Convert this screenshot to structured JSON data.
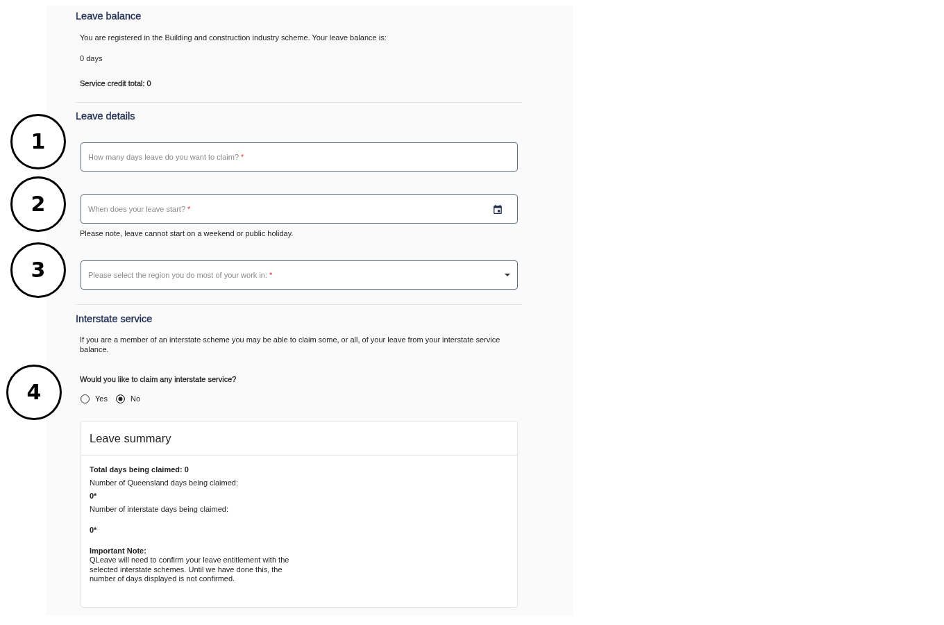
{
  "leave_balance": {
    "heading": "Leave balance",
    "text": "You are registered in the Building and construction industry scheme. Your leave balance is:",
    "balance": "0 days",
    "service_credit": "Service credit total: 0"
  },
  "leave_details": {
    "callout": "1",
    "heading": "Leave details",
    "fields": [
      {
        "kind": "text",
        "placeholder": "How many days leave do you want to claim?",
        "required_mark": "*"
      },
      {
        "kind": "date",
        "callout": "2",
        "placeholder": "When does your leave start?",
        "required_mark": "*",
        "note": "Please note, leave cannot start on a weekend or public holiday."
      },
      {
        "kind": "select",
        "callout": "3",
        "placeholder": "Please select the region you do most of your work in:",
        "required_mark": "*"
      }
    ]
  },
  "interstate_service": {
    "heading": "Interstate service",
    "text": "If you are a member of an interstate scheme you may be able to claim some, or all, of your leave from your interstate service balance.",
    "callout": "4",
    "question": "Would you like to claim any interstate service?",
    "options": [
      {
        "label": "Yes",
        "selected": false
      },
      {
        "label": "No",
        "selected": true
      }
    ]
  },
  "leave_summary": {
    "title": "Leave summary",
    "total": "Total days being claimed: 0",
    "queensland": {
      "label": "Number of Queensland days being claimed:",
      "value": "0*"
    },
    "interstate": {
      "label": "Number of interstate days being claimed:",
      "value": "0*"
    },
    "note": {
      "title": "Important Note:",
      "text": "QLeave will need to confirm your leave entitlement with the selected interstate schemes. Until we have done this, the number of days displayed is not confirmed."
    }
  }
}
